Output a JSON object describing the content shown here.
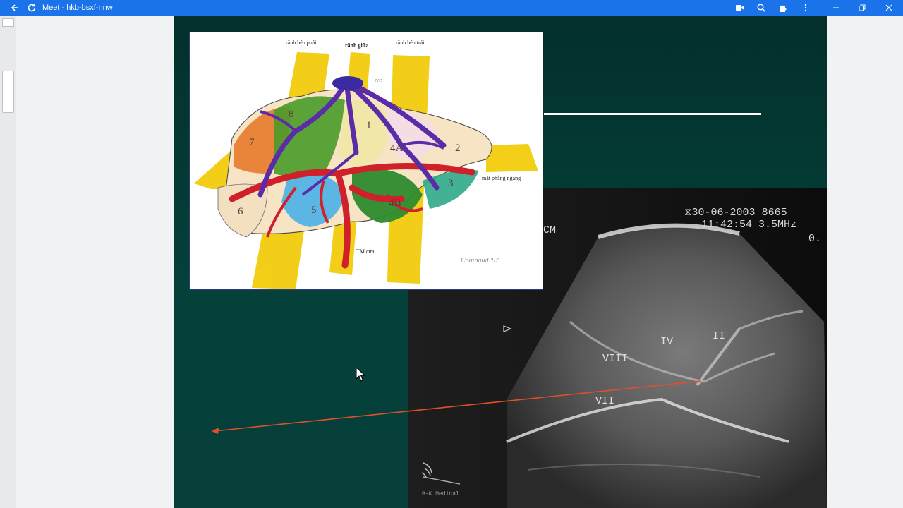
{
  "window": {
    "title": "Meet - hkb-bsxf-nnw",
    "accent": "#1a73e8",
    "toolbar_icons": [
      "camera-icon",
      "zoom-icon",
      "extensions-icon",
      "more-icon"
    ],
    "controls": [
      "minimize-icon",
      "restore-icon",
      "close-icon"
    ]
  },
  "diagram": {
    "labels": {
      "right_lateral": "rãnh bên phải",
      "middle": "rãnh giữa",
      "left_lateral": "rãnh bên trái",
      "ivc": "IVC",
      "horizontal_plane": "mặt phẳng ngang",
      "portal_vein": "TM cửa",
      "signature": "Couinaud '97"
    },
    "segments": [
      "1",
      "2",
      "3",
      "4A",
      "4B",
      "5",
      "6",
      "7",
      "8"
    ]
  },
  "ultrasound": {
    "scale_label": "CM",
    "date": "30-06-2003",
    "code": "8665",
    "time": "11:42:54",
    "frequency": "3.5MHz",
    "value": "0.",
    "segments": [
      "IV",
      "II",
      "VIII",
      "VII"
    ],
    "brand": "B-K Medical"
  }
}
